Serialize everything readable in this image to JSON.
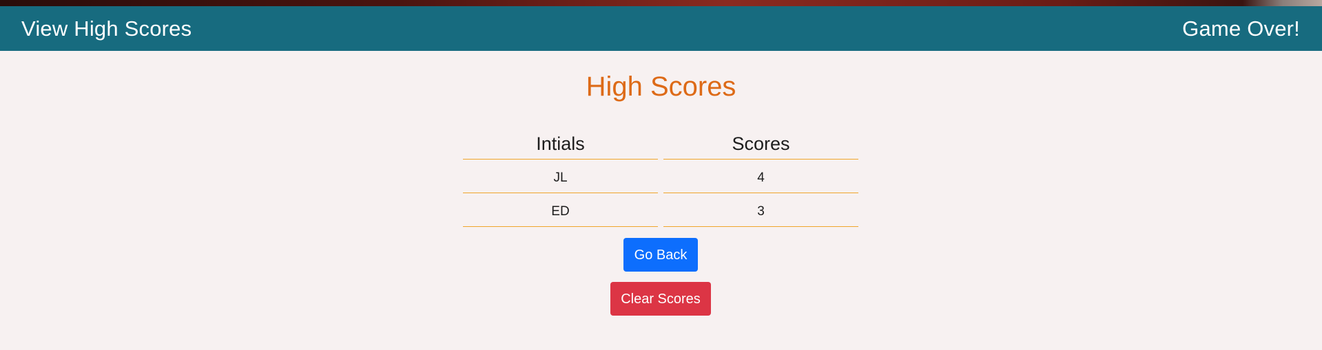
{
  "header": {
    "left_link": "View High Scores",
    "status": "Game Over!"
  },
  "main": {
    "title": "High Scores",
    "table": {
      "columns": [
        "Intials",
        "Scores"
      ],
      "rows": [
        [
          "JL",
          "4"
        ],
        [
          "ED",
          "3"
        ]
      ]
    },
    "buttons": {
      "go_back": "Go Back",
      "clear_scores": "Clear Scores"
    }
  },
  "colors": {
    "header_bg": "#176b7f",
    "title": "#dd6a17",
    "table_border": "#f0a52a",
    "primary_button": "#0d6efd",
    "danger_button": "#dc3545",
    "page_bg": "#f7f1f1"
  }
}
